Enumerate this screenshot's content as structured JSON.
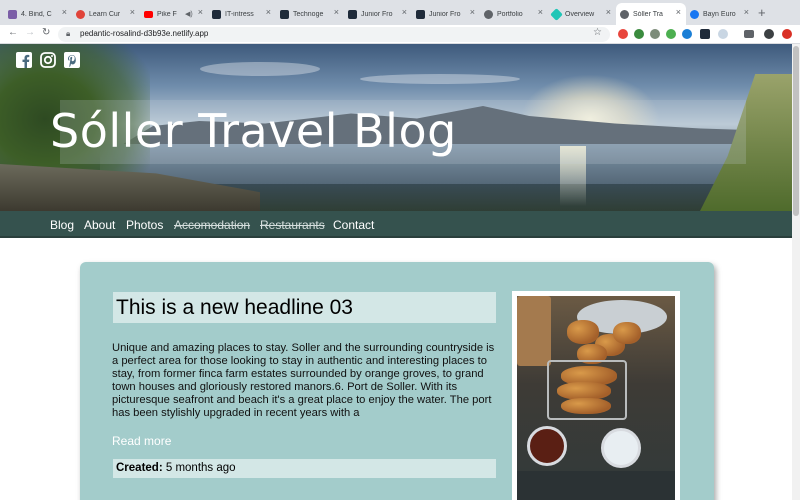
{
  "browser": {
    "tabs": [
      {
        "label": "4. Bind, C",
        "icon": "purple-square-icon",
        "color": "#7b5ea7"
      },
      {
        "label": "Learn Cur",
        "icon": "red-logo-icon",
        "color": "#e0443a"
      },
      {
        "label": "Pike F",
        "icon": "youtube-icon",
        "color": "#ff0000"
      },
      {
        "label": "IT-intress",
        "icon": "dark-logo-icon",
        "color": "#1f2b3a"
      },
      {
        "label": "Technoge",
        "icon": "dark-logo-icon",
        "color": "#1f2b3a"
      },
      {
        "label": "Junior Fro",
        "icon": "dark-logo-icon",
        "color": "#1f2b3a"
      },
      {
        "label": "Junior Fro",
        "icon": "dark-logo-icon",
        "color": "#1f2b3a"
      },
      {
        "label": "Portfolio",
        "icon": "globe-icon",
        "color": "#5f6368"
      },
      {
        "label": "Overview",
        "icon": "netlify-icon",
        "color": "#20c6b7"
      },
      {
        "label": "Sóller Tra",
        "icon": "globe-icon",
        "color": "#5f6368"
      },
      {
        "label": "Bayn Euro",
        "icon": "facebook-icon",
        "color": "#1877f2"
      }
    ],
    "active_tab_index": 9,
    "url": "pedantic-rosalind-d3b93e.netlify.app"
  },
  "site": {
    "title": "Sóller Travel Blog",
    "social": [
      "facebook-icon",
      "instagram-icon",
      "pinterest-icon"
    ],
    "nav": [
      {
        "label": "Blog",
        "struck": false
      },
      {
        "label": "About",
        "struck": false
      },
      {
        "label": "Photos",
        "struck": false
      },
      {
        "label": "Accomodation",
        "struck": true
      },
      {
        "label": "Restaurants",
        "struck": true
      },
      {
        "label": "Contact",
        "struck": false
      }
    ]
  },
  "post": {
    "headline": "This is a new headline 03",
    "body": "Unique and amazing places to stay. Soller and the surrounding countryside is a perfect area for those looking to stay in authentic and interesting places to stay, from former finca farm estates surrounded by orange groves, to grand town houses and gloriously restored manors.6. Port de Soller. With its picturesque seafront and beach it's a great place to enjoy the water. The port has been stylishly upgraded in recent years with a",
    "read_more": "Read more",
    "created_label": "Created:",
    "created_value": "5 months ago"
  },
  "colors": {
    "navbar": "#35524e",
    "card": "#a3cccb",
    "headline_bg": "#d3e7e6"
  }
}
